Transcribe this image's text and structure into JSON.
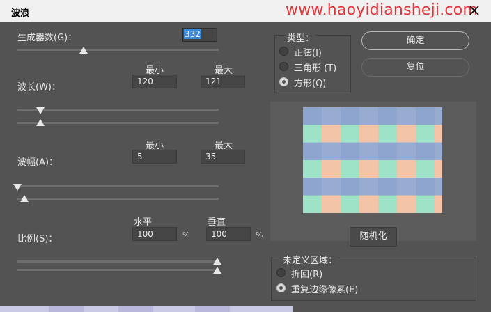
{
  "window": {
    "title": "波浪",
    "watermark": "www.haoyidiansheji.com"
  },
  "generators": {
    "label": "生成器数(G)：",
    "value": "332"
  },
  "wavelength": {
    "label": "波长(W)：",
    "min_header": "最小",
    "max_header": "最大",
    "min": "120",
    "max": "121"
  },
  "amplitude": {
    "label": "波幅(A)：",
    "min_header": "最小",
    "max_header": "最大",
    "min": "5",
    "max": "35"
  },
  "scale": {
    "label": "比例(S)：",
    "h_header": "水平",
    "v_header": "垂直",
    "h": "100",
    "v": "100",
    "unit": "%"
  },
  "type": {
    "title": "类型：",
    "options": [
      {
        "label": "正弦(I)",
        "selected": false
      },
      {
        "label": "三角形 (T)",
        "selected": false
      },
      {
        "label": "方形(Q)",
        "selected": true
      }
    ]
  },
  "buttons": {
    "ok": "确定",
    "reset": "复位",
    "randomize": "随机化"
  },
  "undefined_area": {
    "title": "未定义区域：",
    "options": [
      {
        "label": "折回(R)",
        "selected": false
      },
      {
        "label": "重复边缘像素(E)",
        "selected": true
      }
    ]
  },
  "colors": {
    "preview_blue": "#8ea5cf",
    "preview_mint": "#9ee3c8",
    "preview_peach": "#f4c4a8",
    "watermark": "#e0363a"
  }
}
